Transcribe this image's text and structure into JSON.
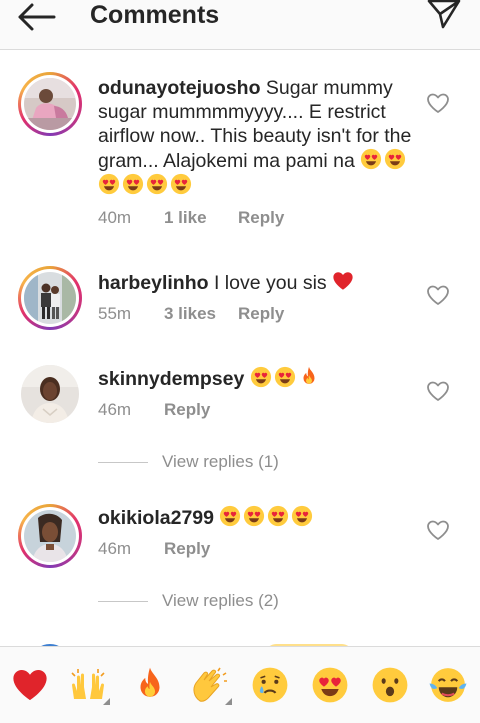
{
  "header": {
    "title": "Comments"
  },
  "comments": [
    {
      "username": "odunayotejuosho",
      "text": " Sugar mummy sugar mummmmyyyy.... E restrict airflow now.. This beauty isn't for the gram... Alajokemi ma pami na",
      "emojis": [
        "heart-eyes",
        "heart-eyes",
        "heart-eyes",
        "heart-eyes",
        "heart-eyes",
        "heart-eyes"
      ],
      "time": "40m",
      "likes": "1 like",
      "reply": "Reply"
    },
    {
      "username": "harbeylinho",
      "text": " I love you sis",
      "emojis": [
        "red-heart"
      ],
      "time": "55m",
      "likes": "3 likes",
      "reply": "Reply"
    },
    {
      "username": "skinnydempsey",
      "text": "",
      "emojis": [
        "heart-eyes",
        "heart-eyes",
        "fire"
      ],
      "time": "46m",
      "likes": "",
      "reply": "Reply",
      "view_replies": "View replies (1)"
    },
    {
      "username": "okikiola2799",
      "text": "",
      "emojis": [
        "heart-eyes",
        "heart-eyes",
        "heart-eyes",
        "heart-eyes"
      ],
      "time": "46m",
      "likes": "",
      "reply": "Reply",
      "view_replies": "View replies (2)"
    }
  ],
  "reactions": [
    "red-heart",
    "raising-hands",
    "fire",
    "clapping-hands",
    "crying-face",
    "heart-eyes",
    "surprised-face",
    "tears-of-joy"
  ],
  "colors": {
    "text": "#262626",
    "secondary": "#8e8e8e",
    "heart_red": "#e0242b",
    "emoji_yellow": "#ffcb3d",
    "border": "#dbdbdb"
  }
}
